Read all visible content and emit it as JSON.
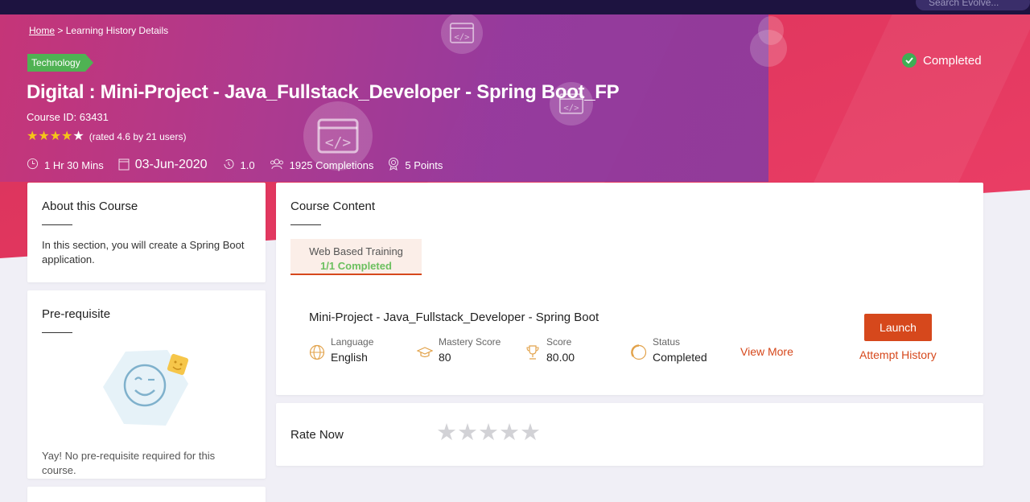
{
  "topbar": {
    "search_placeholder": "Search Evolve..."
  },
  "breadcrumb": {
    "home": "Home",
    "separator": ">",
    "current": "Learning History Details"
  },
  "course": {
    "category": "Technology",
    "status": "Completed",
    "title": "Digital : Mini-Project - Java_Fullstack_Developer - Spring Boot_FP",
    "course_id": "Course ID: 63431",
    "rating_value": 4.6,
    "rating_text": "(rated 4.6 by 21 users)",
    "duration": "1 Hr 30 Mins",
    "date": "03-Jun-2020",
    "version": "1.0",
    "completions": "1925 Completions",
    "points": "5 Points"
  },
  "about": {
    "heading": "About this Course",
    "text": "In this section, you will create a Spring Boot application."
  },
  "prereq": {
    "heading": "Pre-requisite",
    "text": "Yay! No pre-requisite required for this course."
  },
  "content": {
    "heading": "Course Content",
    "tab_label": "Web Based Training",
    "tab_progress": "1/1 Completed",
    "item": {
      "title": "Mini-Project - Java_Fullstack_Developer - Spring Boot",
      "language_label": "Language",
      "language": "English",
      "mastery_label": "Mastery Score",
      "mastery": "80",
      "score_label": "Score",
      "score": "80.00",
      "status_label": "Status",
      "status": "Completed",
      "view_more": "View More",
      "launch": "Launch",
      "attempt_history": "Attempt History"
    }
  },
  "rate": {
    "label": "Rate Now",
    "stars_selected": 0,
    "stars_total": 5
  },
  "colors": {
    "accent": "#d6481c",
    "success": "#4fb253",
    "star": "#f5c518"
  }
}
